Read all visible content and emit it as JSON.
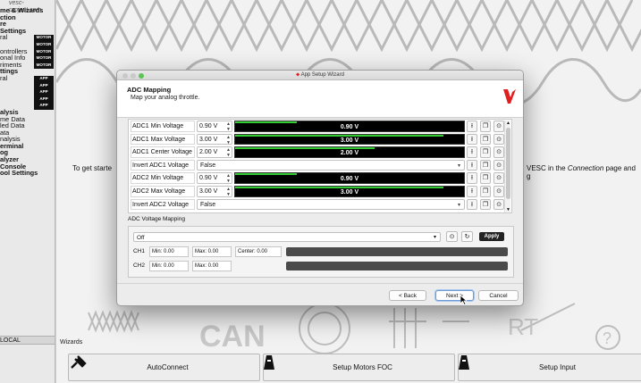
{
  "left_panel": {
    "url": "vesc-project.com",
    "items": [
      {
        "text": "me & Wizards",
        "bold": true
      },
      {
        "text": "ction",
        "bold": true
      },
      {
        "text": "re",
        "bold": true
      },
      {
        "text": "Settings",
        "bold": true
      },
      {
        "text": "ral",
        "bold": false,
        "tag": "MOTOR"
      },
      {
        "text": "",
        "bold": false,
        "tag": "MOTOR"
      },
      {
        "text": "ontrollers",
        "bold": false,
        "tag": "MOTOR"
      },
      {
        "text": "onal Info",
        "bold": false,
        "tag": "MOTOR"
      },
      {
        "text": "riments",
        "bold": false,
        "tag": "MOTOR"
      },
      {
        "text": "ttings",
        "bold": true
      },
      {
        "text": "ral",
        "bold": false,
        "tag": "APP"
      },
      {
        "text": "",
        "bold": false,
        "tag": "APP"
      },
      {
        "text": "",
        "bold": false,
        "tag": "APP"
      },
      {
        "text": "",
        "bold": false,
        "tag": "APP"
      },
      {
        "text": "",
        "bold": false,
        "tag": "APP"
      },
      {
        "text": "alysis",
        "bold": true
      },
      {
        "text": "me Data",
        "bold": false
      },
      {
        "text": "led Data",
        "bold": false
      },
      {
        "text": "ata",
        "bold": false
      },
      {
        "text": "nalysis",
        "bold": false
      },
      {
        "text": "erminal",
        "bold": true
      },
      {
        "text": "og",
        "bold": true
      },
      {
        "text": "alyzer",
        "bold": true
      },
      {
        "text": "Console",
        "bold": true
      },
      {
        "text": "ool Settings",
        "bold": true
      }
    ],
    "local_label": "LOCAL"
  },
  "background": {
    "text_left": "To get starte",
    "text_right_prefix": "VESC in the ",
    "text_right_em": "Connection",
    "text_right_suffix": " page and g",
    "wizards_label": "Wizards",
    "wizard_buttons": [
      "AutoConnect",
      "Setup Motors FOC",
      "Setup Input"
    ]
  },
  "dialog": {
    "window_title": "App Setup Wizard",
    "heading": "ADC Mapping",
    "subheading": "Map your analog throttle.",
    "params": [
      {
        "label": "ADC1 Min Voltage",
        "spin": "0.90 V",
        "bar": "0.90 V",
        "fill": 0.27
      },
      {
        "label": "ADC1 Max Voltage",
        "spin": "3.00 V",
        "bar": "3.00 V",
        "fill": 0.91
      },
      {
        "label": "ADC1 Center Voltage",
        "spin": "2.00 V",
        "bar": "2.00 V",
        "fill": 0.61
      },
      {
        "label": "Invert ADC1 Voltage",
        "bool": "False"
      },
      {
        "label": "ADC2 Min Voltage",
        "spin": "0.90 V",
        "bar": "0.90 V",
        "fill": 0.27
      },
      {
        "label": "ADC2 Max Voltage",
        "spin": "3.00 V",
        "bar": "3.00 V",
        "fill": 0.91
      },
      {
        "label": "Invert ADC2 Voltage",
        "bool": "False"
      }
    ],
    "mapping": {
      "label": "ADC Voltage Mapping",
      "mode": "Off",
      "apply": "Apply",
      "ch1": {
        "name": "CH1",
        "min": "Min: 0.00",
        "max": "Max: 0.00",
        "center": "Center: 0.00"
      },
      "ch2": {
        "name": "CH2",
        "min": "Min: 0.00",
        "max": "Max: 0.00"
      }
    },
    "buttons": {
      "back": "< Back",
      "next": "Next >",
      "cancel": "Cancel"
    }
  },
  "colors": {
    "bar_fill": "#33cc33",
    "brand": "#e02020",
    "apply_bg": "#222222"
  }
}
